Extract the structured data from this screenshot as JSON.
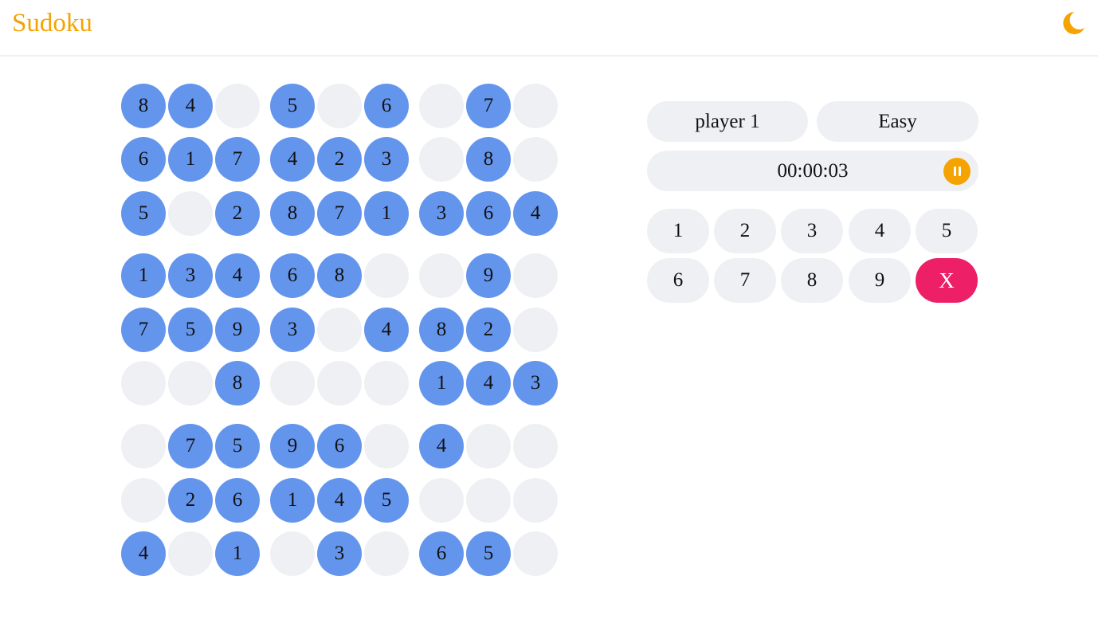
{
  "app": {
    "title": "Sudoku",
    "theme_icon": "moon-icon",
    "accent_color": "#f5a300"
  },
  "board": {
    "rows": [
      [
        "8",
        "4",
        "",
        "5",
        "",
        "6",
        "",
        "7",
        ""
      ],
      [
        "6",
        "1",
        "7",
        "4",
        "2",
        "3",
        "",
        "8",
        ""
      ],
      [
        "5",
        "",
        "2",
        "8",
        "7",
        "1",
        "3",
        "6",
        "4"
      ],
      [
        "1",
        "3",
        "4",
        "6",
        "8",
        "",
        "",
        "9",
        ""
      ],
      [
        "7",
        "5",
        "9",
        "3",
        "",
        "4",
        "8",
        "2",
        ""
      ],
      [
        "",
        "",
        "8",
        "",
        "",
        "",
        "1",
        "4",
        "3"
      ],
      [
        "",
        "7",
        "5",
        "9",
        "6",
        "",
        "4",
        "",
        ""
      ],
      [
        "",
        "2",
        "6",
        "1",
        "4",
        "5",
        "",
        "",
        ""
      ],
      [
        "4",
        "",
        "1",
        "",
        "3",
        "",
        "6",
        "5",
        ""
      ]
    ],
    "filled_color": "#6495ed",
    "empty_color": "#eff0f4"
  },
  "panel": {
    "player": "player 1",
    "difficulty": "Easy",
    "timer": "00:00:03",
    "pause_icon": "pause-icon",
    "keypad": [
      "1",
      "2",
      "3",
      "4",
      "5",
      "6",
      "7",
      "8",
      "9"
    ],
    "clear_label": "X",
    "clear_color": "#ec1f67"
  }
}
